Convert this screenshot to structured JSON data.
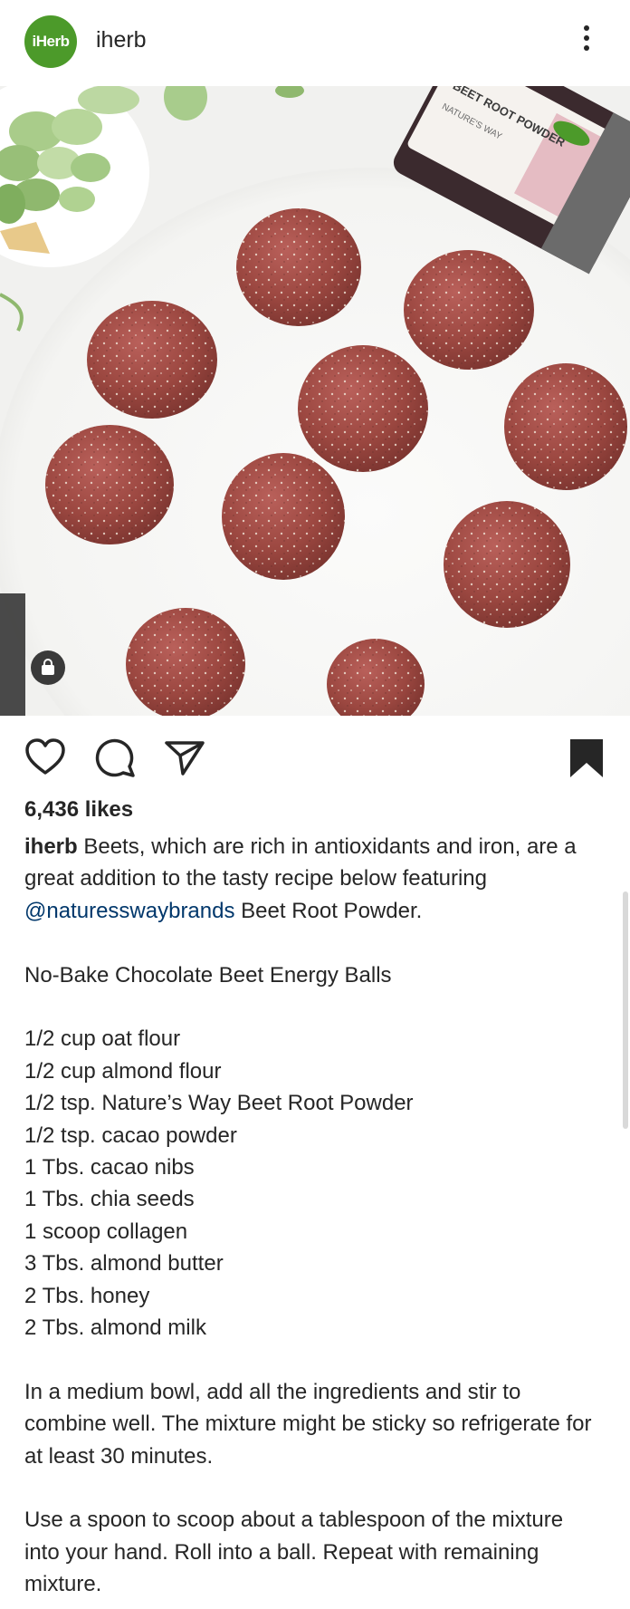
{
  "header": {
    "avatar_text": "iHerb",
    "username": "iherb",
    "menu_icon": "kebab-menu-icon"
  },
  "photo": {
    "jar_label_1": "BEET ROOT POWDER",
    "jar_label_2": "NATURE'S WAY",
    "shop_icon": "shopping-bag-icon"
  },
  "actions": {
    "like_icon": "heart-icon",
    "comment_icon": "comment-icon",
    "share_icon": "send-icon",
    "save_icon": "bookmark-icon"
  },
  "post": {
    "likes": "6,436 likes",
    "caption_user": "iherb",
    "caption_intro_a": " Beets, which are rich in antioxidants and iron, are a great addition to the tasty recipe below featuring ",
    "mention": "@naturesswaybrands",
    "caption_intro_b": " Beet Root Powder.",
    "recipe_title": "No-Bake Chocolate Beet Energy Balls",
    "ingredients": [
      "1/2 cup oat flour",
      "1/2 cup almond flour",
      "1/2 tsp. Nature’s Way Beet Root Powder",
      "1/2 tsp. cacao powder",
      "1 Tbs. cacao nibs",
      "1 Tbs. chia seeds",
      "1 scoop collagen",
      "3 Tbs. almond butter",
      "2 Tbs. honey",
      "2 Tbs. almond milk"
    ],
    "step_1": "In a medium bowl, add all the ingredients and stir to combine well. The mixture might be sticky so refrigerate for at least 30 minutes.",
    "step_2": "Use a spoon to scoop about a tablespoon of the mixture into your hand. Roll into a ball. Repeat with remaining mixture."
  },
  "colors": {
    "avatar_green": "#4c9a2a",
    "mention_blue": "#00376b",
    "text": "#262626"
  }
}
